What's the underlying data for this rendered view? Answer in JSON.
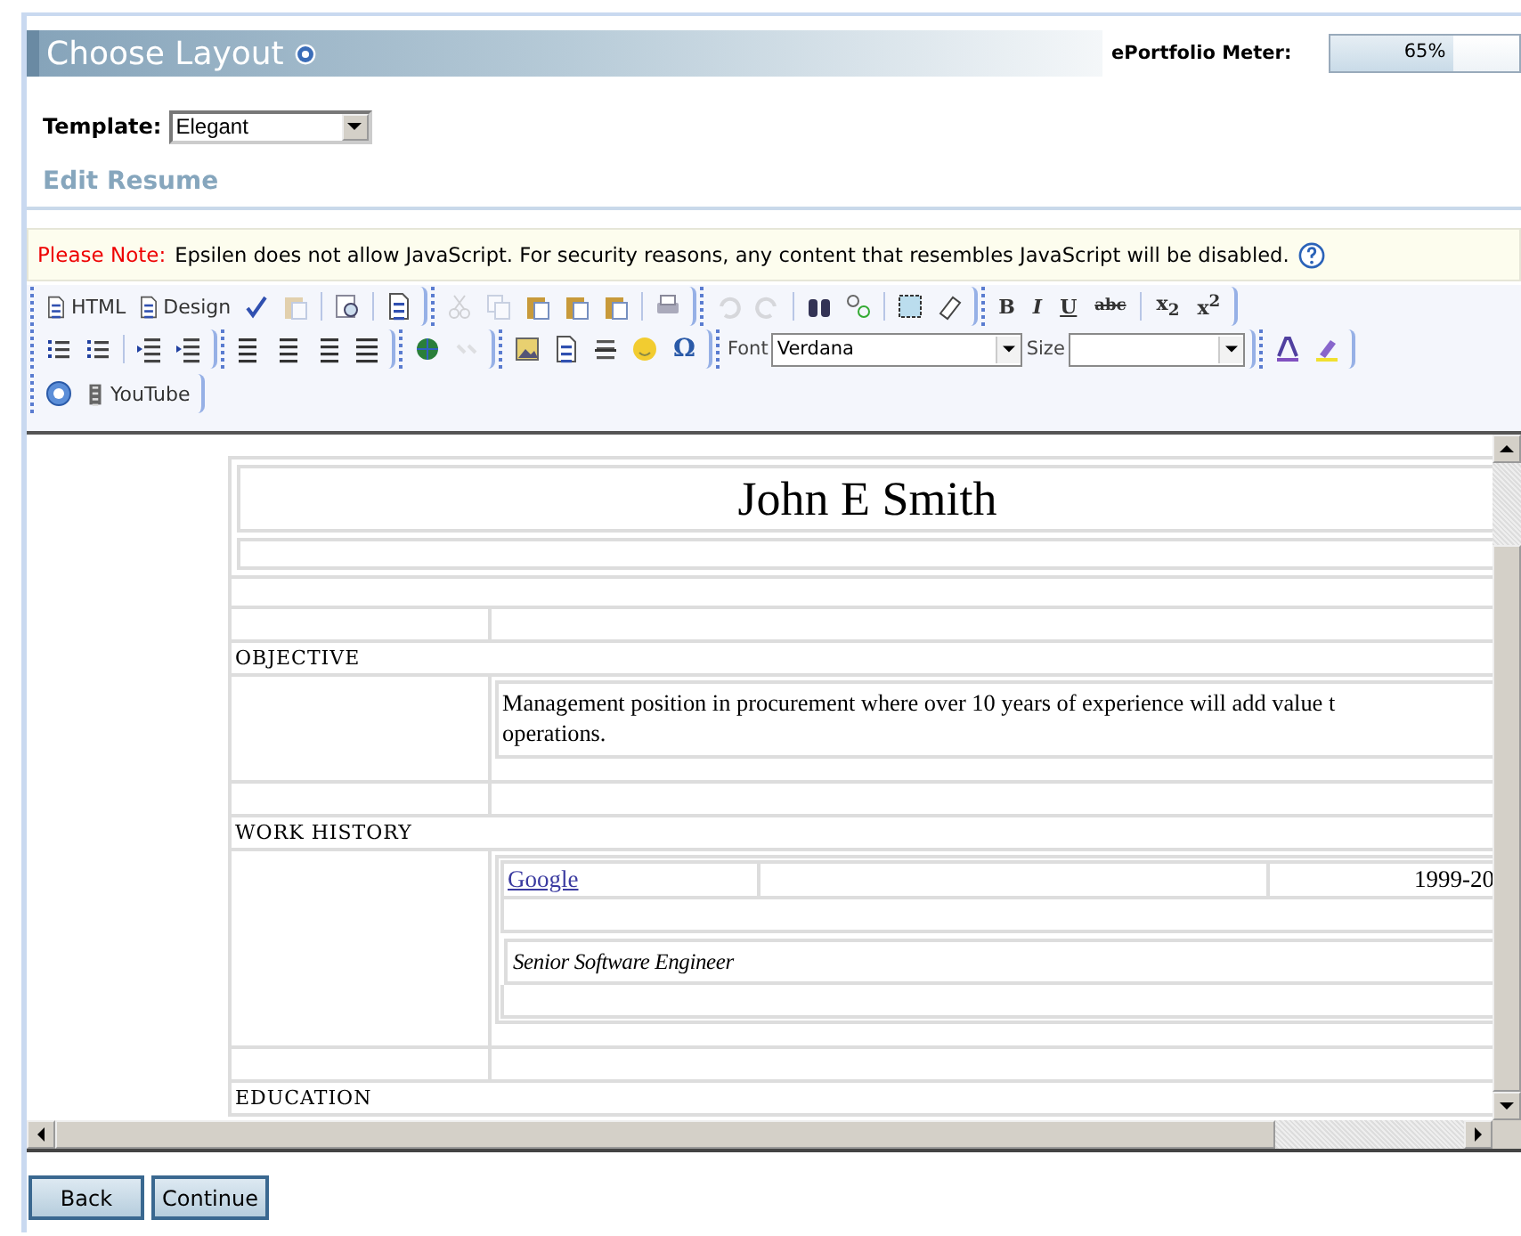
{
  "header": {
    "title": "Choose Layout",
    "meter_label": "ePortfolio Meter:",
    "meter": {
      "level": 0.65,
      "reading": "65%"
    }
  },
  "template": {
    "label": "Template:",
    "value": "Elegant"
  },
  "section_title": "Edit Resume",
  "note": {
    "label": "Please Note:",
    "text": "Epsilen does not allow JavaScript. For security reasons, any content that resembles JavaScript will be disabled."
  },
  "toolbar": [
    [
      [
        {
          "kind": "labeled",
          "label": "HTML"
        },
        {
          "kind": "labeled",
          "label": "Design"
        },
        {
          "kind": "icon",
          "disabled": false
        },
        {
          "kind": "icon",
          "disabled": true
        },
        {
          "kind": "sep"
        },
        {
          "kind": "icon",
          "disabled": false
        },
        {
          "kind": "sep"
        },
        {
          "kind": "icon",
          "disabled": false
        }
      ],
      [
        {
          "kind": "icon",
          "disabled": true
        },
        {
          "kind": "icon",
          "disabled": true
        },
        {
          "kind": "icon",
          "disabled": false
        },
        {
          "kind": "icon",
          "disabled": false
        },
        {
          "kind": "icon",
          "disabled": false
        },
        {
          "kind": "sep"
        },
        {
          "kind": "icon",
          "disabled": false
        }
      ],
      [
        {
          "kind": "icon",
          "disabled": true
        },
        {
          "kind": "icon",
          "disabled": true
        },
        {
          "kind": "sep"
        },
        {
          "kind": "icon",
          "disabled": false
        },
        {
          "kind": "icon",
          "disabled": false
        },
        {
          "kind": "sep"
        },
        {
          "kind": "icon",
          "disabled": false
        },
        {
          "kind": "icon",
          "disabled": false
        }
      ],
      [
        {
          "kind": "glyph",
          "text": "B"
        },
        {
          "kind": "glyph",
          "text": "I"
        },
        {
          "kind": "glyph",
          "text": "U"
        },
        {
          "kind": "glyph",
          "text": "abc"
        },
        {
          "kind": "sep"
        },
        {
          "kind": "glyph",
          "text": "x$_{2}$"
        },
        {
          "kind": "glyph",
          "text": "x$^{2}$"
        }
      ]
    ],
    [
      [
        {
          "kind": "icon",
          "disabled": false
        },
        {
          "kind": "icon",
          "disabled": false
        },
        {
          "kind": "sep"
        },
        {
          "kind": "icon",
          "disabled": false
        },
        {
          "kind": "icon",
          "disabled": false
        }
      ],
      [
        {
          "kind": "icon",
          "disabled": false
        },
        {
          "kind": "icon",
          "disabled": false
        },
        {
          "kind": "icon",
          "disabled": false
        },
        {
          "kind": "icon",
          "disabled": false
        }
      ],
      [
        {
          "kind": "icon",
          "disabled": false
        },
        {
          "kind": "icon",
          "disabled": true
        }
      ],
      [
        {
          "kind": "icon",
          "disabled": false
        },
        {
          "kind": "icon",
          "disabled": false
        },
        {
          "kind": "icon",
          "disabled": false
        },
        {
          "kind": "icon",
          "disabled": false
        },
        {
          "kind": "glyph",
          "text": "Ω"
        }
      ],
      [
        {
          "kind": "label",
          "text": "Font"
        },
        {
          "kind": "select",
          "value": "Verdana"
        },
        {
          "kind": "label",
          "text": "Size"
        },
        {
          "kind": "select"
        }
      ],
      [
        {
          "kind": "icon",
          "disabled": false
        },
        {
          "kind": "icon",
          "disabled": false
        }
      ]
    ],
    [
      [
        {
          "kind": "icon",
          "disabled": false
        },
        {
          "kind": "labeled",
          "label": "YouTube"
        }
      ]
    ]
  ],
  "resume": {
    "name": "John E Smith",
    "sections": [
      {
        "heading": "OBJECTIVE",
        "kind": "text",
        "lines": [
          "Management position in procurement where over 10 years of experience will add value t",
          "operations."
        ]
      },
      {
        "heading": "WORK HISTORY",
        "kind": "job",
        "employer": "Google",
        "dates": "1999-20",
        "title": "Senior Software Engineer"
      },
      {
        "heading": "EDUCATION",
        "kind": "heading"
      }
    ]
  },
  "buttons": [
    {
      "label": "Back"
    },
    {
      "label": "Continue"
    }
  ]
}
